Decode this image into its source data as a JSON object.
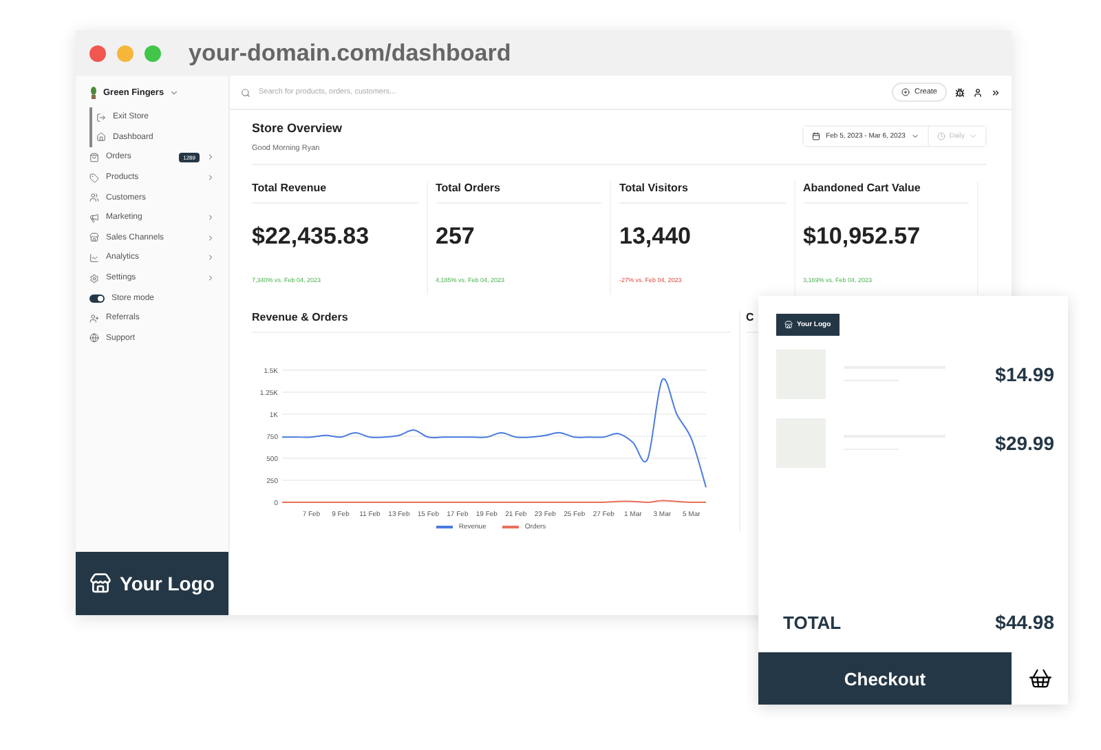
{
  "browser": {
    "url": "your-domain.com/dashboard"
  },
  "sidebar": {
    "store_name": "Green Fingers",
    "items": [
      {
        "kind": "link",
        "label": "Exit Store"
      },
      {
        "kind": "link",
        "label": "Dashboard"
      },
      {
        "kind": "nav",
        "label": "Orders",
        "badge": "1289",
        "expandable": true
      },
      {
        "kind": "nav",
        "label": "Products",
        "expandable": true
      },
      {
        "kind": "nav",
        "label": "Customers",
        "expandable": false
      },
      {
        "kind": "nav",
        "label": "Marketing",
        "expandable": true
      },
      {
        "kind": "nav",
        "label": "Sales Channels",
        "expandable": true
      },
      {
        "kind": "nav",
        "label": "Analytics",
        "expandable": true
      },
      {
        "kind": "nav",
        "label": "Settings",
        "expandable": true
      },
      {
        "kind": "toggle",
        "label": "Store mode",
        "on": true
      },
      {
        "kind": "nav",
        "label": "Referrals",
        "expandable": false
      },
      {
        "kind": "nav",
        "label": "Support",
        "expandable": false
      }
    ],
    "logo": "Your Logo"
  },
  "topbar": {
    "search": {
      "placeholder": "Search for products, orders, customers..."
    },
    "create_button": "Create"
  },
  "header": {
    "title": "Store Overview",
    "greeting": "Good Morning Ryan",
    "date_range": "Feb 5, 2023 - Mar 6, 2023",
    "interval": {
      "label": "Daily",
      "disabled": true
    }
  },
  "stats": [
    {
      "title": "Total Revenue",
      "value": "$22,435.83",
      "delta": "7,340% vs. Feb 04, 2023",
      "positive": true
    },
    {
      "title": "Total Orders",
      "value": "257",
      "delta": "4,185% vs. Feb 04, 2023",
      "positive": true
    },
    {
      "title": "Total Visitors",
      "value": "13,440",
      "delta": "-27% vs. Feb 04, 2023",
      "positive": false
    },
    {
      "title": "Abandoned Cart Value",
      "value": "$10,952.57",
      "delta": "3,169% vs. Feb 04, 2023",
      "positive": true
    }
  ],
  "revenue_panel": {
    "title": "Revenue & Orders",
    "chart_data": {
      "type": "line",
      "categories": [
        null,
        null,
        "7 Feb",
        null,
        "9 Feb",
        null,
        "11 Feb",
        null,
        "13 Feb",
        null,
        "15 Feb",
        null,
        "17 Feb",
        null,
        "19 Feb",
        null,
        "21 Feb",
        null,
        "23 Feb",
        null,
        "25 Feb",
        null,
        "27 Feb",
        null,
        "1 Mar",
        null,
        "3 Mar",
        null,
        "5 Mar",
        null
      ],
      "ylim": [
        0,
        1500
      ],
      "grid": true,
      "yticks": [
        {
          "value": 0,
          "label": "0"
        },
        {
          "value": 250,
          "label": "250"
        },
        {
          "value": 500,
          "label": "500"
        },
        {
          "value": 750,
          "label": "750"
        },
        {
          "value": 1000,
          "label": "1K"
        },
        {
          "value": 1250,
          "label": "1.25K"
        },
        {
          "value": 1500,
          "label": "1.5K"
        }
      ],
      "series": [
        {
          "name": "Revenue",
          "color": "#4a7be0",
          "values": [
            740,
            740,
            740,
            760,
            740,
            790,
            740,
            740,
            760,
            820,
            740,
            740,
            740,
            740,
            740,
            790,
            740,
            740,
            760,
            790,
            740,
            740,
            740,
            780,
            680,
            490,
            1390,
            1000,
            720,
            170
          ]
        },
        {
          "name": "Orders",
          "color": "#e8705a",
          "values": [
            0,
            0,
            0,
            0,
            0,
            0,
            0,
            0,
            0,
            0,
            0,
            0,
            0,
            0,
            0,
            0,
            0,
            0,
            0,
            0,
            0,
            0,
            0,
            10,
            10,
            0,
            20,
            10,
            0,
            0
          ]
        }
      ]
    }
  },
  "second_panel": {
    "title": "C"
  },
  "cart": {
    "logo": "Your Logo",
    "items": [
      {
        "price": "$14.99"
      },
      {
        "price": "$29.99"
      }
    ],
    "total_label": "TOTAL",
    "total": "$44.98",
    "checkout": "Checkout"
  }
}
